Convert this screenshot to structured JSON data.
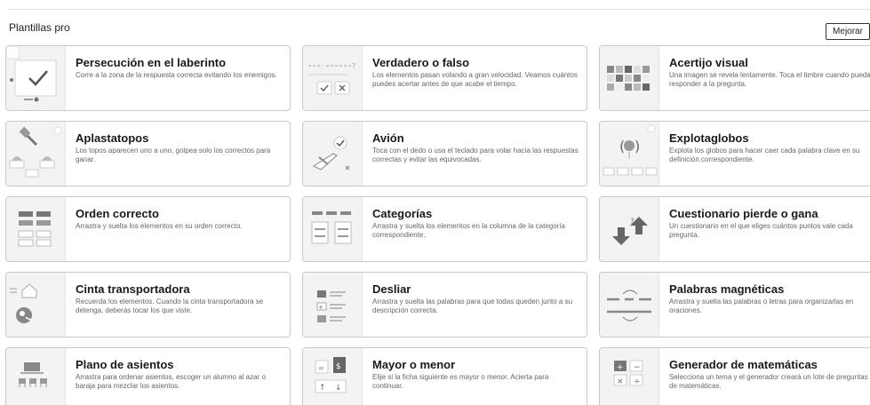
{
  "section": {
    "title": "Plantillas pro",
    "upgrade_label": "Mejorar"
  },
  "templates": [
    {
      "title": "Persecución en el laberinto",
      "desc": "Corre a la zona de la respuesta correcta evitando los enemigos.",
      "icon": "maze-chase-icon"
    },
    {
      "title": "Verdadero o falso",
      "desc": "Los elementos pasan volando a gran velocidad. Veamos cuántos puedes acertar antes de que acabe el tiempo.",
      "icon": "true-false-icon"
    },
    {
      "title": "Acertijo visual",
      "desc": "Una imagen se revela lentamente. Toca el timbre cuando puedas responder a la pregunta.",
      "icon": "image-reveal-icon"
    },
    {
      "title": "Aplastatopos",
      "desc": "Los topos aparecen uno a uno, golpea solo los correctos para ganar.",
      "icon": "whack-a-mole-icon"
    },
    {
      "title": "Avión",
      "desc": "Toca con el dedo o usa el teclado para volar hacia las respuestas correctas y evitar las equivocadas.",
      "icon": "airplane-icon"
    },
    {
      "title": "Explotaglobos",
      "desc": "Explota los globos para hacer caer cada palabra clave en su definición correspondiente.",
      "icon": "balloon-pop-icon"
    },
    {
      "title": "Orden correcto",
      "desc": "Arrastra y suelta los elementos en su orden correcto.",
      "icon": "rank-order-icon"
    },
    {
      "title": "Categorías",
      "desc": "Arrastra y suelta los elementos en la columna de la categoría correspondiente.",
      "icon": "group-sort-icon"
    },
    {
      "title": "Cuestionario pierde o gana",
      "desc": "Un cuestionario en el que eliges cuántos puntos vale cada pregunta.",
      "icon": "win-lose-quiz-icon"
    },
    {
      "title": "Cinta transportadora",
      "desc": "Recuerda los elementos. Cuando la cinta transportadora se detenga, deberás tocar los que viste.",
      "icon": "conveyor-belt-icon"
    },
    {
      "title": "Desliar",
      "desc": "Arrastra y suelta las palabras para que todas queden junto a su descripción correcta.",
      "icon": "unjumble-icon"
    },
    {
      "title": "Palabras magnéticas",
      "desc": "Arrastra y suelta las palabras o letras para organizarlas en oraciones.",
      "icon": "word-magnets-icon"
    },
    {
      "title": "Plano de asientos",
      "desc": "Arrastra para ordenar asientos, escoger un alumno al azar o baraja para mezclar los asientos.",
      "icon": "seating-plan-icon"
    },
    {
      "title": "Mayor o menor",
      "desc": "Elije si la ficha siguiente es mayor o menor. Acierta para continuar.",
      "icon": "higher-lower-icon"
    },
    {
      "title": "Generador de matemáticas",
      "desc": "Selecciona un tema y el generador creará un lote de preguntas de matemáticas.",
      "icon": "math-generator-icon"
    }
  ],
  "colors": {
    "border": "#c9c9c9",
    "thumb_bg": "#f3f3f3",
    "icon_gray": "#9a9a9a",
    "icon_dark": "#555555"
  }
}
